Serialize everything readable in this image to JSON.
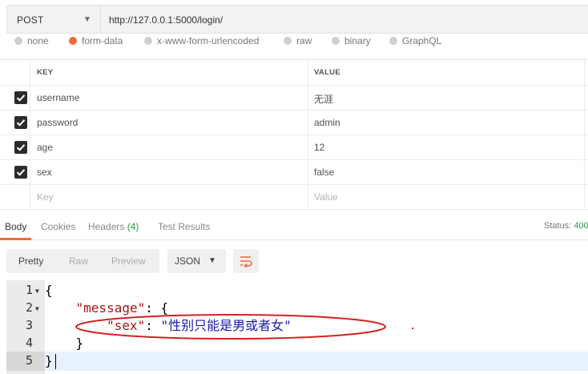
{
  "request": {
    "method": "POST",
    "url": "http://127.0.0.1:5000/login/"
  },
  "body_types": [
    {
      "label": "none",
      "selected": false
    },
    {
      "label": "form-data",
      "selected": true
    },
    {
      "label": "x-www-form-urlencoded",
      "selected": false
    },
    {
      "label": "raw",
      "selected": false
    },
    {
      "label": "binary",
      "selected": false
    },
    {
      "label": "GraphQL",
      "selected": false
    }
  ],
  "params": {
    "header_key": "KEY",
    "header_value": "VALUE",
    "rows": [
      {
        "checked": true,
        "key": "username",
        "value": "无涯"
      },
      {
        "checked": true,
        "key": "password",
        "value": "admin"
      },
      {
        "checked": true,
        "key": "age",
        "value": "12"
      },
      {
        "checked": true,
        "key": "sex",
        "value": "false"
      }
    ],
    "placeholder_key": "Key",
    "placeholder_value": "Value"
  },
  "response_tabs": {
    "body": "Body",
    "cookies": "Cookies",
    "headers": "Headers",
    "headers_count": "(4)",
    "test_results": "Test Results"
  },
  "status": {
    "label": "Status:",
    "code": "400"
  },
  "toolbar": {
    "pretty": "Pretty",
    "raw": "Raw",
    "preview": "Preview",
    "format": "JSON"
  },
  "code": {
    "line_numbers": [
      "1",
      "2",
      "3",
      "4",
      "5"
    ],
    "line1": "{",
    "line2_key": "\"message\"",
    "line2_rest": ": {",
    "line3_key": "\"sex\"",
    "line3_sep": ": ",
    "line3_value": "\"性别只能是男或者女\"",
    "line4": "}",
    "line5": "}"
  },
  "colors": {
    "accent": "#f26b3a",
    "status_code": "#2e9a4a",
    "annotation": "#d22222"
  }
}
